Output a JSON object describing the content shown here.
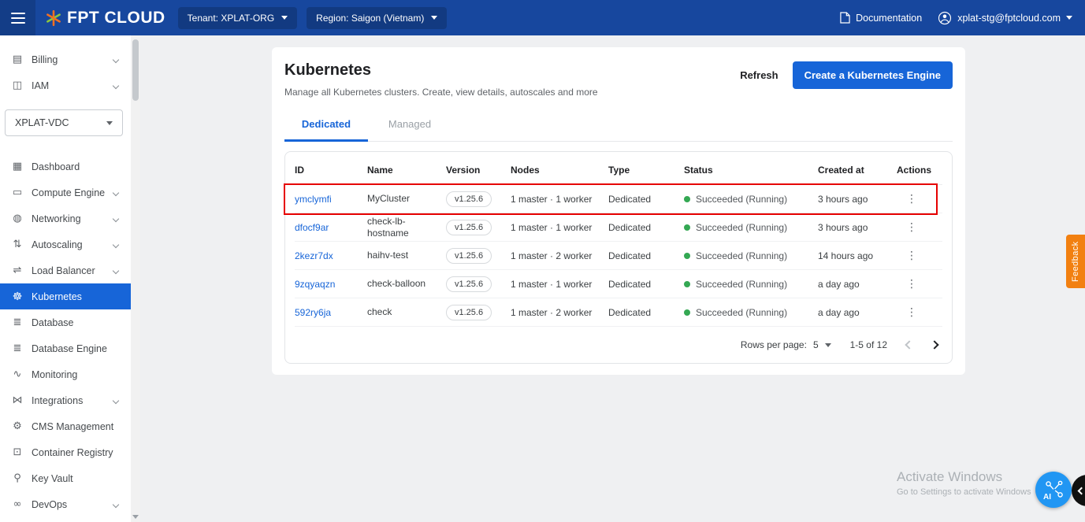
{
  "colors": {
    "topbar": "#17479E",
    "accent": "#1765D8",
    "success": "#34A853",
    "feedback": "#F28011",
    "annotation": "#E60000"
  },
  "topbar": {
    "brand": "FPT CLOUD",
    "tenant": "Tenant: XPLAT-ORG",
    "region": "Region: Saigon (Vietnam)",
    "documentation_label": "Documentation",
    "account_email": "xplat-stg@fptcloud.com"
  },
  "sidebar": {
    "top_items": [
      {
        "label": "Billing",
        "icon": "billing-icon"
      },
      {
        "label": "IAM",
        "icon": "iam-icon"
      }
    ],
    "vdc_select_value": "XPLAT-VDC",
    "items": [
      {
        "label": "Dashboard",
        "icon": "dashboard-icon"
      },
      {
        "label": "Compute Engine",
        "icon": "compute-engine-icon"
      },
      {
        "label": "Networking",
        "icon": "networking-icon"
      },
      {
        "label": "Autoscaling",
        "icon": "autoscaling-icon"
      },
      {
        "label": "Load Balancer",
        "icon": "load-balancer-icon"
      },
      {
        "label": "Kubernetes",
        "icon": "kubernetes-icon"
      },
      {
        "label": "Database",
        "icon": "database-icon"
      },
      {
        "label": "Database Engine",
        "icon": "database-engine-icon"
      },
      {
        "label": "Monitoring",
        "icon": "monitoring-icon"
      },
      {
        "label": "Integrations",
        "icon": "integrations-icon"
      },
      {
        "label": "CMS Management",
        "icon": "cms-management-icon"
      },
      {
        "label": "Container Registry",
        "icon": "container-registry-icon"
      },
      {
        "label": "Key Vault",
        "icon": "key-vault-icon"
      },
      {
        "label": "DevOps",
        "icon": "devops-icon"
      }
    ]
  },
  "page": {
    "title": "Kubernetes",
    "subtitle": "Manage all Kubernetes clusters. Create, view details, autoscales and more",
    "refresh_label": "Refresh",
    "create_button_label": "Create a Kubernetes Engine",
    "tabs": [
      {
        "label": "Dedicated"
      },
      {
        "label": "Managed"
      }
    ]
  },
  "table": {
    "headers": [
      "ID",
      "Name",
      "Version",
      "Nodes",
      "Type",
      "Status",
      "Created at",
      "Actions"
    ],
    "rows": [
      {
        "id": "ymclymfi",
        "name": "MyCluster",
        "version": "v1.25.6",
        "nodes": "1 master · 1 worker",
        "type": "Dedicated",
        "status": "Succeeded (Running)",
        "created_at": "3 hours ago"
      },
      {
        "id": "dfocf9ar",
        "name": "check-lb-hostname",
        "version": "v1.25.6",
        "nodes": "1 master · 1 worker",
        "type": "Dedicated",
        "status": "Succeeded (Running)",
        "created_at": "3 hours ago"
      },
      {
        "id": "2kezr7dx",
        "name": "haihv-test",
        "version": "v1.25.6",
        "nodes": "1 master · 2 worker",
        "type": "Dedicated",
        "status": "Succeeded (Running)",
        "created_at": "14 hours ago"
      },
      {
        "id": "9zqyaqzn",
        "name": "check-balloon",
        "version": "v1.25.6",
        "nodes": "1 master · 1 worker",
        "type": "Dedicated",
        "status": "Succeeded (Running)",
        "created_at": "a day ago"
      },
      {
        "id": "592ry6ja",
        "name": "check",
        "version": "v1.25.6",
        "nodes": "1 master · 2 worker",
        "type": "Dedicated",
        "status": "Succeeded (Running)",
        "created_at": "a day ago"
      }
    ],
    "pagination": {
      "rows_per_page_label": "Rows per page:",
      "rows_per_page_value": "5",
      "range_label": "1-5 of 12"
    }
  },
  "feedback_tab_label": "Feedback",
  "watermark": {
    "line1": "Activate Windows",
    "line2": "Go to Settings to activate Windows"
  },
  "assistant": {
    "ai_label": "AI"
  }
}
